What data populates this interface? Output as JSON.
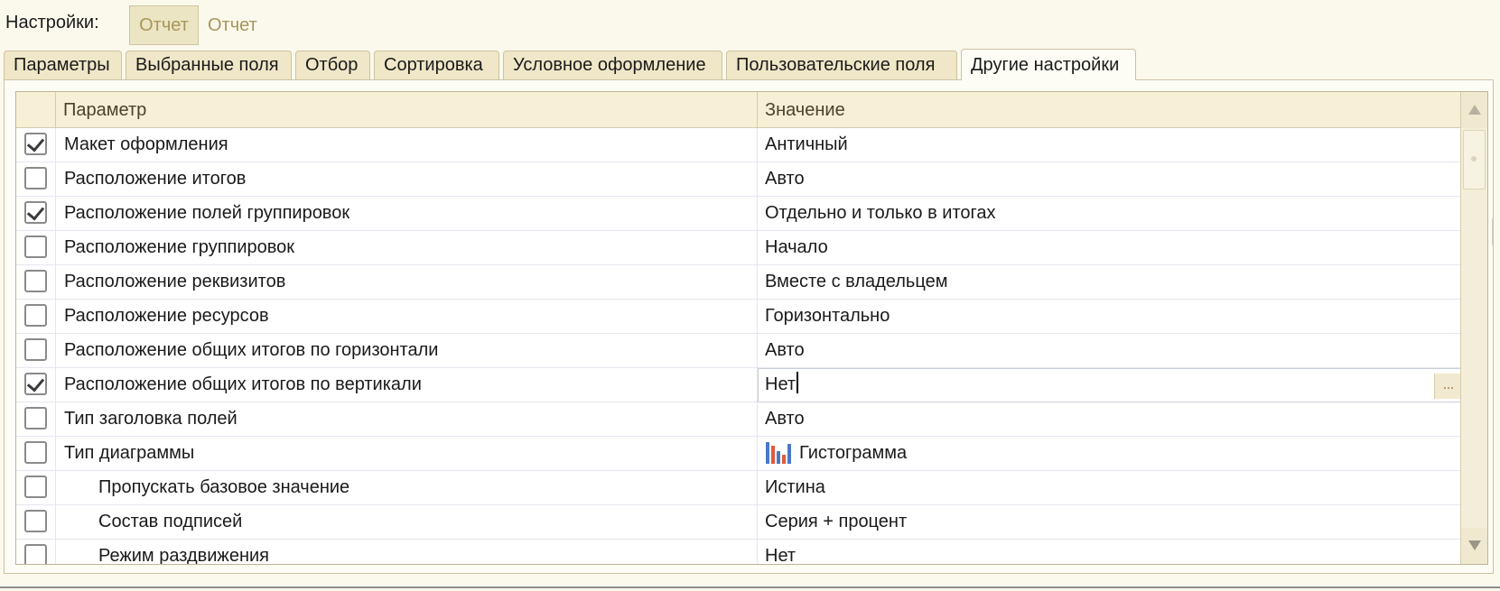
{
  "settings": {
    "label": "Настройки:",
    "variant_button": "Отчет",
    "variant_link": "Отчет"
  },
  "tabs": [
    {
      "label": "Параметры",
      "active": false
    },
    {
      "label": "Выбранные поля",
      "active": false
    },
    {
      "label": "Отбор",
      "active": false
    },
    {
      "label": "Сортировка",
      "active": false
    },
    {
      "label": "Условное оформление",
      "active": false
    },
    {
      "label": "Пользовательские поля",
      "active": false
    },
    {
      "label": "Другие настройки",
      "active": true
    }
  ],
  "table": {
    "columns": {
      "param": "Параметр",
      "value": "Значение"
    },
    "rows": [
      {
        "checked": true,
        "param": "Макет оформления",
        "value": "Античный"
      },
      {
        "checked": false,
        "param": "Расположение итогов",
        "value": "Авто"
      },
      {
        "checked": true,
        "param": "Расположение полей группировок",
        "value": "Отдельно и только в итогах"
      },
      {
        "checked": false,
        "param": "Расположение группировок",
        "value": "Начало"
      },
      {
        "checked": false,
        "param": "Расположение реквизитов",
        "value": "Вместе с владельцем"
      },
      {
        "checked": false,
        "param": "Расположение ресурсов",
        "value": "Горизонтально"
      },
      {
        "checked": false,
        "param": "Расположение общих итогов по горизонтали",
        "value": "Авто"
      },
      {
        "checked": true,
        "param": "Расположение общих итогов по вертикали",
        "value": "Нет",
        "editing": true,
        "select_button": "..."
      },
      {
        "checked": false,
        "param": "Тип заголовка полей",
        "value": "Авто"
      },
      {
        "checked": false,
        "param": "Тип диаграммы",
        "value": "Гистограмма",
        "icon": "bar-chart-icon"
      },
      {
        "checked": false,
        "param": "Пропускать базовое значение",
        "value": "Истина",
        "indent": true
      },
      {
        "checked": false,
        "param": "Состав подписей",
        "value": "Серия + процент",
        "indent": true
      },
      {
        "checked": false,
        "param": "Режим раздвижения",
        "value": "Нет",
        "indent": true
      }
    ]
  },
  "colors": {
    "background": "#fbf9ec",
    "header": "#f7f0d6",
    "accent_text": "#a7955a",
    "border": "#cdc2a0"
  }
}
